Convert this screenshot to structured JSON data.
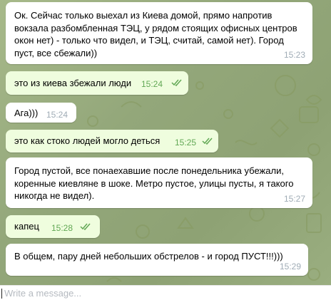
{
  "messages": [
    {
      "text": "Ок. Сейчас только выехал из Киева домой, прямо напротив вокзала разбомбленная ТЭЦ, у рядом стоящих офисных центров окон нет) - только что видел, и ТЭЦ, считай, самой нет). Город пуст, все сбежали))",
      "time": "15:23",
      "direction": "incoming"
    },
    {
      "text": "это из киева збежали люди",
      "time": "15:24",
      "direction": "outgoing",
      "read": true
    },
    {
      "text": "Ага)))",
      "time": "15:24",
      "direction": "incoming"
    },
    {
      "text": "это как стоко людей могло деться",
      "time": "15:25",
      "direction": "outgoing",
      "read": true
    },
    {
      "text": "Город пустой, все понаехавшие  после понедельника убежали, коренные киевляне в шоке. Метро пустое, улицы пусты, я такого никогда не видел).",
      "time": "15:27",
      "direction": "incoming"
    },
    {
      "text": "капец",
      "time": "15:28",
      "direction": "outgoing",
      "read": true
    },
    {
      "text": "В общем, пару дней небольших обстрелов - и город ПУСТ!!!)))",
      "time": "15:29",
      "direction": "incoming"
    }
  ],
  "composer": {
    "placeholder": "Write a message..."
  },
  "colors": {
    "incoming_bubble": "#ffffff",
    "outgoing_bubble": "#effdde",
    "outgoing_time": "#62a855",
    "background": "#94a679"
  }
}
